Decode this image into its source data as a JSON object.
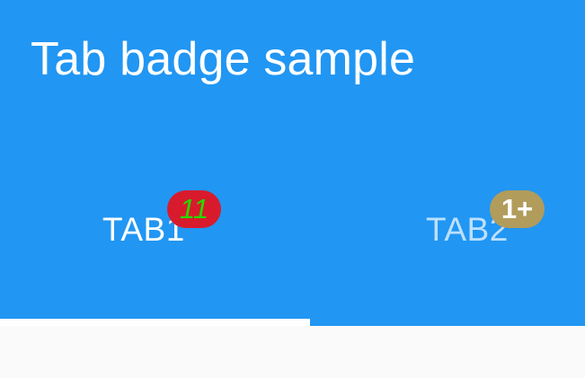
{
  "app_bar": {
    "title": "Tab badge sample",
    "background_color": "#2196f3"
  },
  "tabs": [
    {
      "label": "TAB1",
      "selected": true,
      "badge": {
        "text": "11",
        "background_color": "#d81b2c",
        "text_color": "#22dd00"
      }
    },
    {
      "label": "TAB2",
      "selected": false,
      "badge": {
        "text": "1+",
        "background_color": "#b19c5c",
        "text_color": "#ffffff"
      }
    }
  ],
  "indicator_color": "#ffffff"
}
